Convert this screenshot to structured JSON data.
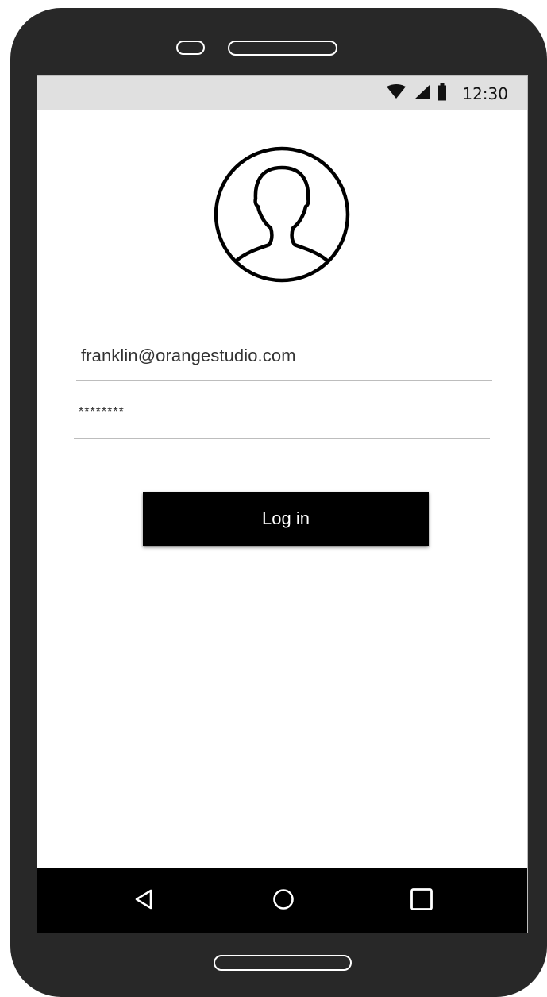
{
  "status_bar": {
    "time": "12:30",
    "icons": [
      "wifi-icon",
      "signal-icon",
      "battery-icon"
    ]
  },
  "login": {
    "avatar_icon": "user-avatar-icon",
    "email_value": "franklin@orangestudio.com",
    "password_value": "********",
    "button_label": "Log in"
  },
  "nav_bar": {
    "buttons": [
      "back-icon",
      "home-icon",
      "recent-apps-icon"
    ]
  },
  "colors": {
    "device_body": "#282828",
    "status_bar": "#e0e0e0",
    "screen": "#ffffff",
    "button": "#000000",
    "button_text": "#ffffff",
    "nav_bar": "#000000",
    "divider": "#bdbdbd"
  }
}
